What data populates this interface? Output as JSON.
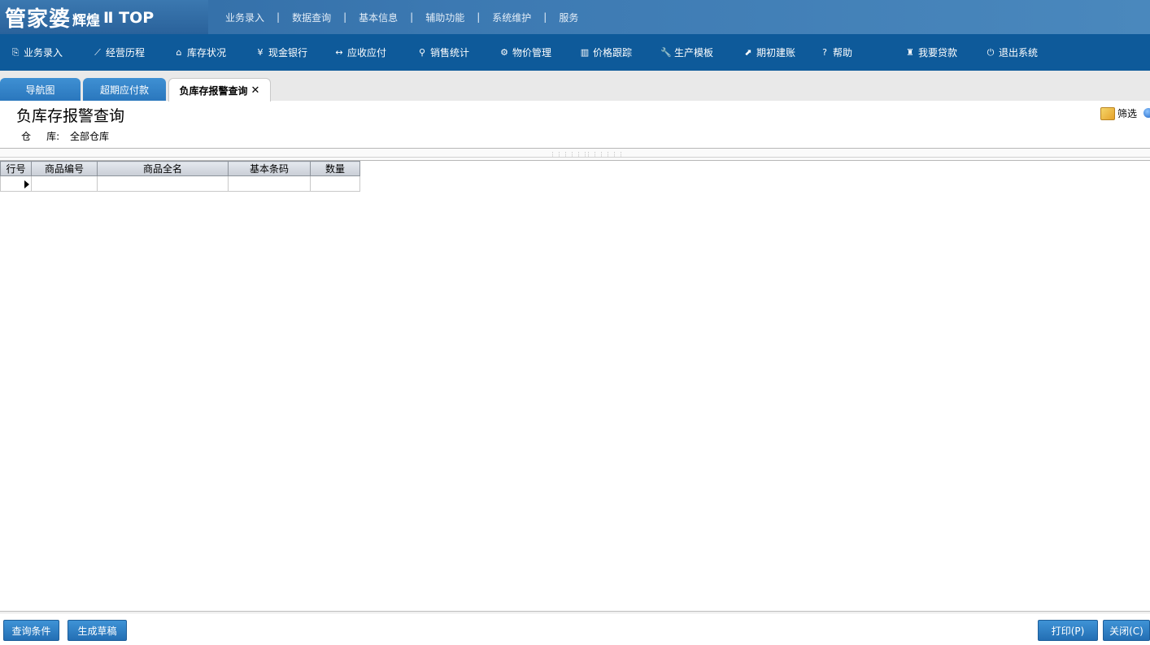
{
  "app": {
    "logo_main": "管家婆",
    "logo_sub": "辉煌",
    "logo_version": "Ⅱ TOP"
  },
  "top_menu": [
    "业务录入",
    "数据查询",
    "基本信息",
    "辅助功能",
    "系统维护",
    "服务"
  ],
  "top_menu_separator": "|",
  "toolbar": [
    {
      "icon": "document-icon",
      "glyph": "⎘",
      "label": "业务录入"
    },
    {
      "icon": "line-chart-icon",
      "glyph": "⟋",
      "label": "经营历程"
    },
    {
      "icon": "home-icon",
      "glyph": "⌂",
      "label": "库存状况"
    },
    {
      "icon": "yen-icon",
      "glyph": "¥",
      "label": "现金银行"
    },
    {
      "icon": "arrows-icon",
      "glyph": "↔",
      "label": "应收应付"
    },
    {
      "icon": "search-icon",
      "glyph": "⚲",
      "label": "销售统计"
    },
    {
      "icon": "gear-icon",
      "glyph": "⚙",
      "label": "物价管理"
    },
    {
      "icon": "bar-chart-icon",
      "glyph": "▥",
      "label": "价格跟踪"
    },
    {
      "icon": "wrench-icon",
      "glyph": "🔧",
      "label": "生产模板"
    },
    {
      "icon": "external-link-icon",
      "glyph": "⬈",
      "label": "期初建账"
    },
    {
      "icon": "question-icon",
      "glyph": "?",
      "label": "帮助"
    },
    {
      "icon": "money-bag-icon",
      "glyph": "♜",
      "label": "我要贷款"
    },
    {
      "icon": "power-icon",
      "glyph": "⏻",
      "label": "退出系统"
    }
  ],
  "tabs": [
    {
      "label": "导航图",
      "active": false
    },
    {
      "label": "超期应付款",
      "active": false
    },
    {
      "label": "负库存报警查询",
      "active": true,
      "close_glyph": "✕"
    }
  ],
  "page": {
    "title": "负库存报警查询",
    "warehouse_label": "仓     库:",
    "warehouse_value": "全部仓库",
    "filter_label": "筛选"
  },
  "grid": {
    "columns": [
      "行号",
      "商品编号",
      "商品全名",
      "基本条码",
      "数量"
    ],
    "rows": [
      [
        "",
        "",
        "",
        "",
        ""
      ]
    ]
  },
  "buttons": {
    "query_conditions": "查询条件",
    "generate_draft": "生成草稿",
    "print": "打印(P)",
    "close": "关闭(C)"
  }
}
